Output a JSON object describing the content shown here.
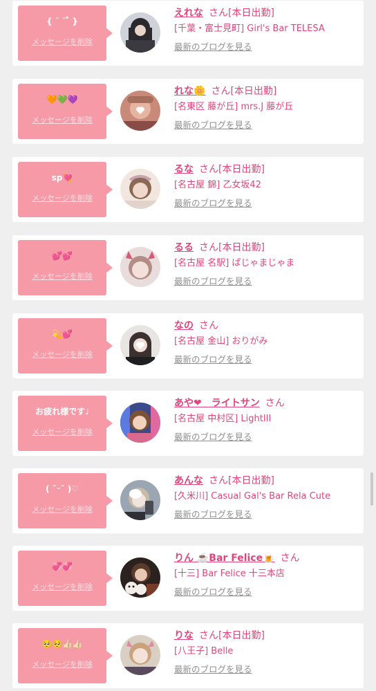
{
  "delete_label": "メッセージを削除",
  "blog_label": "最新のブログを見る",
  "san_label": "さん",
  "colors": {
    "bubble": "#f59aa6",
    "accent": "#e0457b",
    "muted": "#8f8f8f"
  },
  "items": [
    {
      "message": "{ ˘ ˘ ͒ }",
      "name": "えれな",
      "status": "[本日出勤]",
      "shop": "[千葉・富士見町] Girl's Bar TELESA",
      "avatar": "avatar-dark-hair"
    },
    {
      "message": "🧡💚💜",
      "name": "れな🌼",
      "status": "[本日出勤]",
      "shop": "[名東区 藤が丘] mrs.J 藤が丘",
      "avatar": "avatar-heart-sticker"
    },
    {
      "message": "sp💘",
      "name": "るな",
      "status": "[本日出勤]",
      "shop": "[名古屋 錦] 乙女坂42",
      "avatar": "avatar-headband"
    },
    {
      "message": "💕💕",
      "name": "るる",
      "status": "[本日出勤]",
      "shop": "[名古屋 名駅] ぱじゃまじゃま",
      "avatar": "avatar-bunny-ears"
    },
    {
      "message": "💫💕",
      "name": "なの",
      "status": "",
      "shop": "[名古屋 金山] おりがみ",
      "avatar": "avatar-heart-face"
    },
    {
      "message": "お疲れ様です♩",
      "name": "あや❤︎　ライトサン",
      "status": "",
      "shop": "[名古屋 中村区] LightIII",
      "avatar": "avatar-neon-light"
    },
    {
      "message": "( ˘ᵕ˘ )♡",
      "name": "あんな",
      "status": "[本日出勤]",
      "shop": "[久米川] Casual Gal's Bar Rela Cute",
      "avatar": "avatar-mirror-selfie"
    },
    {
      "message": "💞💞",
      "name": "りん ☕️Bar Felice🍺",
      "status": "",
      "shop": "[十三] Bar Felice 十三本店",
      "avatar": "avatar-with-dog"
    },
    {
      "message": "🥺🥺👍🏻👍🏻",
      "name": "りな",
      "status": "[本日出勤]",
      "shop": "[八王子] Belle",
      "avatar": "avatar-light-hair"
    }
  ]
}
